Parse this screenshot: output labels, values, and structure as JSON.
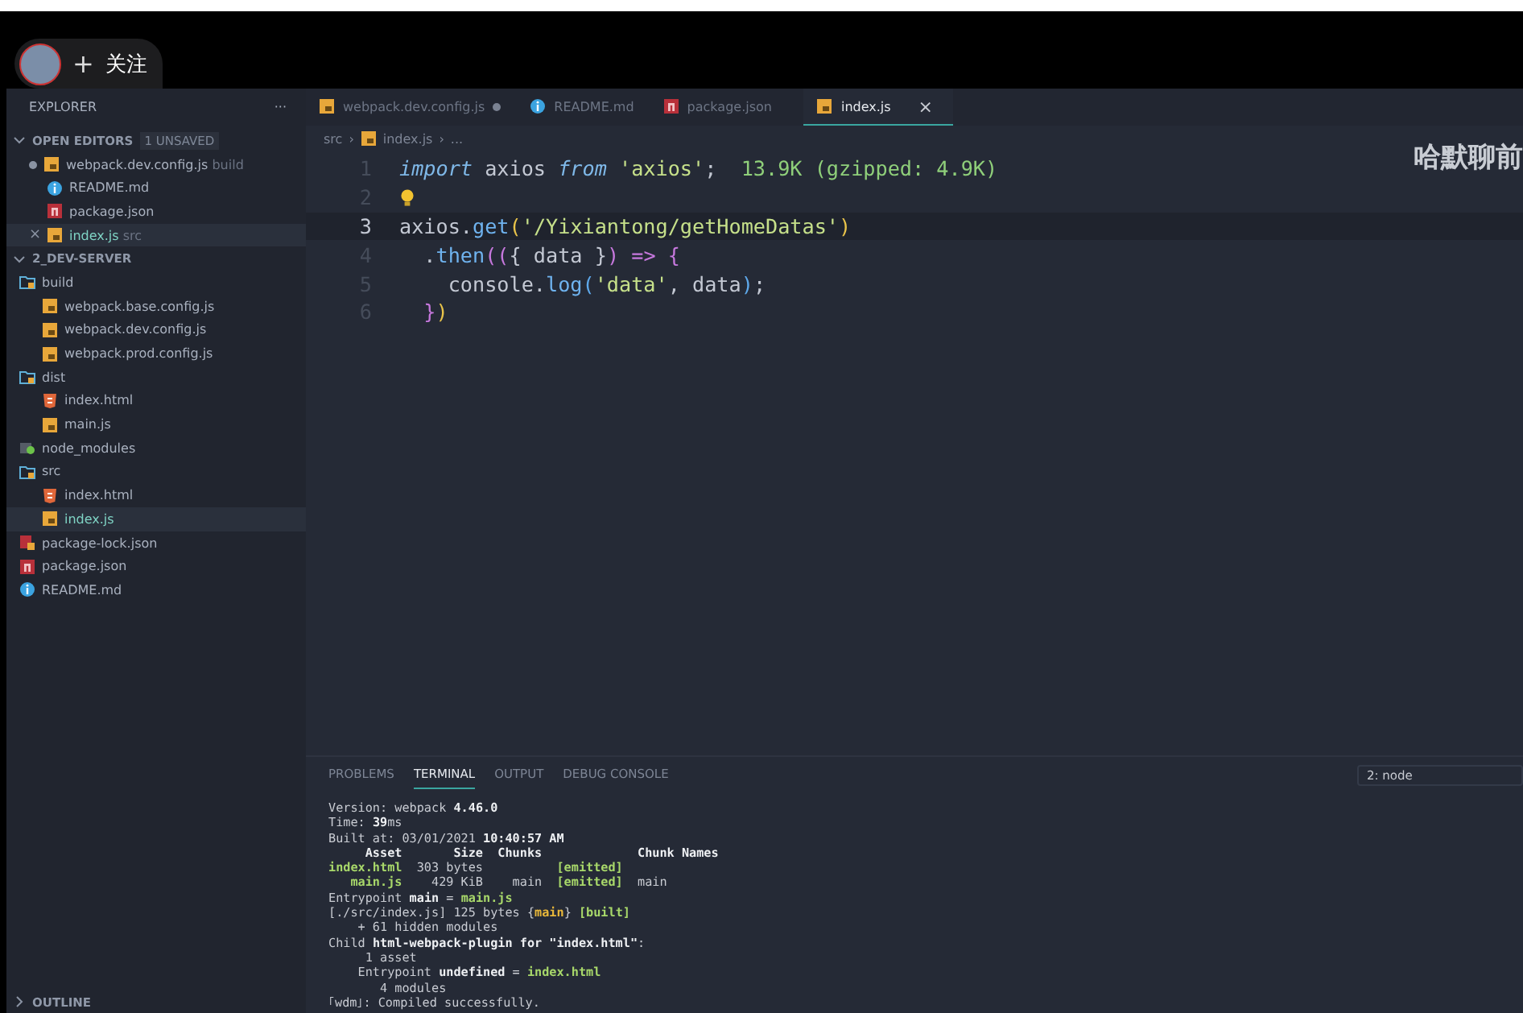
{
  "follow_button": {
    "icon": "+",
    "label": "关注"
  },
  "overlay_title": "哈默聊前",
  "sidebar": {
    "title": "EXPLORER",
    "more": "···",
    "open_editors": {
      "title": "OPEN EDITORS",
      "badge": "1 UNSAVED",
      "expanded": true,
      "items": [
        {
          "name": "webpack.dev.config.js",
          "hint": "build",
          "kind": "js",
          "dirty": true,
          "selected": false
        },
        {
          "name": "README.md",
          "kind": "info",
          "dirty": false,
          "selected": false
        },
        {
          "name": "package.json",
          "kind": "npm",
          "dirty": false,
          "selected": false
        },
        {
          "name": "index.js",
          "hint": "src",
          "kind": "js",
          "dirty": false,
          "selected": true,
          "close": "×"
        }
      ]
    },
    "project": {
      "title": "2_DEV-SERVER",
      "expanded": true,
      "tree": [
        {
          "name": "build",
          "kind": "folder",
          "expanded": true,
          "selected": false,
          "children": [
            {
              "name": "webpack.base.config.js",
              "kind": "js",
              "selected": false
            },
            {
              "name": "webpack.dev.config.js",
              "kind": "js",
              "selected": false
            },
            {
              "name": "webpack.prod.config.js",
              "kind": "js",
              "selected": false
            }
          ]
        },
        {
          "name": "dist",
          "kind": "folder",
          "expanded": true,
          "selected": false,
          "children": [
            {
              "name": "index.html",
              "kind": "html",
              "selected": false
            },
            {
              "name": "main.js",
              "kind": "js",
              "selected": false
            }
          ]
        },
        {
          "name": "node_modules",
          "kind": "node-folder",
          "expanded": false,
          "selected": false
        },
        {
          "name": "src",
          "kind": "folder",
          "expanded": true,
          "selected": false,
          "children": [
            {
              "name": "index.html",
              "kind": "html",
              "selected": false
            },
            {
              "name": "index.js",
              "kind": "js",
              "selected": true
            }
          ]
        },
        {
          "name": "package-lock.json",
          "kind": "npm-lock",
          "selected": false
        },
        {
          "name": "package.json",
          "kind": "npm",
          "selected": false
        },
        {
          "name": "README.md",
          "kind": "info",
          "selected": false
        }
      ]
    },
    "outline": {
      "title": "OUTLINE",
      "expanded": false
    }
  },
  "editor": {
    "tabs": [
      {
        "label": "webpack.dev.config.js",
        "kind": "js",
        "dirty": true,
        "selected": false
      },
      {
        "label": "README.md",
        "kind": "info",
        "dirty": false,
        "selected": false
      },
      {
        "label": "package.json",
        "kind": "npm",
        "dirty": false,
        "selected": false
      },
      {
        "label": "index.js",
        "kind": "js",
        "dirty": false,
        "selected": true,
        "close": "×"
      }
    ],
    "breadcrumb_separator": "›",
    "breadcrumb": [
      {
        "text": "src",
        "kind": "folder"
      },
      {
        "text": "index.js",
        "kind": "js"
      },
      {
        "text": "...",
        "kind": "more"
      }
    ],
    "lines": [
      {
        "number": "1",
        "active": false,
        "lightbulb": false,
        "tokens": [
          {
            "text": "import",
            "kind": "kw"
          },
          {
            "text": " axios ",
            "kind": "id"
          },
          {
            "text": "from",
            "kind": "kw"
          },
          {
            "text": " 'axios'",
            "kind": "str"
          },
          {
            "text": ";",
            "kind": "id"
          },
          {
            "text": "  13.9K (gzipped: 4.9K)",
            "kind": "cost"
          }
        ]
      },
      {
        "number": "2",
        "active": false,
        "lightbulb": true
      },
      {
        "number": "3",
        "active": true,
        "lightbulb": false,
        "tokens": [
          {
            "text": "axios",
            "kind": "id"
          },
          {
            "text": ".",
            "kind": "id"
          },
          {
            "text": "get",
            "kind": "fn"
          },
          {
            "text": "(",
            "kind": "p1"
          },
          {
            "text": "'/Yixiantong/getHomeDatas'",
            "kind": "str"
          },
          {
            "text": ")",
            "kind": "p1"
          }
        ]
      },
      {
        "number": "4",
        "active": false,
        "lightbulb": false,
        "tokens": [
          {
            "text": "  .",
            "kind": "id"
          },
          {
            "text": "then",
            "kind": "fn"
          },
          {
            "text": "((",
            "kind": "p2"
          },
          {
            "text": "{ data }",
            "kind": "id"
          },
          {
            "text": ")",
            "kind": "p2"
          },
          {
            "text": " => ",
            "kind": "kw2"
          },
          {
            "text": "{",
            "kind": "p2"
          }
        ]
      },
      {
        "number": "5",
        "active": false,
        "lightbulb": false,
        "tokens": [
          {
            "text": "    console.",
            "kind": "id"
          },
          {
            "text": "log",
            "kind": "fn"
          },
          {
            "text": "(",
            "kind": "p3"
          },
          {
            "text": "'data'",
            "kind": "str"
          },
          {
            "text": ", data",
            "kind": "id"
          },
          {
            "text": ")",
            "kind": "p3"
          },
          {
            "text": ";",
            "kind": "id"
          }
        ]
      },
      {
        "number": "6",
        "active": false,
        "lightbulb": false,
        "tokens": [
          {
            "text": "  }",
            "kind": "p2"
          },
          {
            "text": ")",
            "kind": "p1"
          }
        ]
      }
    ]
  },
  "panel": {
    "tabs": [
      {
        "label": "PROBLEMS",
        "selected": false
      },
      {
        "label": "TERMINAL",
        "selected": true
      },
      {
        "label": "OUTPUT",
        "selected": false
      },
      {
        "label": "DEBUG CONSOLE",
        "selected": false
      }
    ],
    "terminal_select": "2: node",
    "lines": [
      [
        {
          "text": "Version: webpack ",
          "kind": "plain"
        },
        {
          "text": "4.46.0",
          "kind": "bold"
        }
      ],
      [
        {
          "text": "Time: ",
          "kind": "plain"
        },
        {
          "text": "39",
          "kind": "bold"
        },
        {
          "text": "ms",
          "kind": "plain"
        }
      ],
      [
        {
          "text": "Built at: 03/01/2021 ",
          "kind": "plain"
        },
        {
          "text": "10:40:57 AM",
          "kind": "bold"
        }
      ],
      [
        {
          "text": "     Asset       Size  Chunks             Chunk Names",
          "kind": "bold"
        }
      ],
      [
        {
          "text": "index.html",
          "kind": "green"
        },
        {
          "text": "  303 bytes          ",
          "kind": "plain"
        },
        {
          "text": "[emitted]",
          "kind": "green"
        }
      ],
      [
        {
          "text": "   main.js",
          "kind": "green"
        },
        {
          "text": "    429 KiB    main  ",
          "kind": "plain"
        },
        {
          "text": "[emitted]",
          "kind": "green"
        },
        {
          "text": "  main",
          "kind": "plain"
        }
      ],
      [
        {
          "text": "Entrypoint ",
          "kind": "plain"
        },
        {
          "text": "main",
          "kind": "bold"
        },
        {
          "text": " = ",
          "kind": "plain"
        },
        {
          "text": "main.js",
          "kind": "green"
        }
      ],
      [
        {
          "text": "[./src/index.js] 125 bytes {",
          "kind": "plain"
        },
        {
          "text": "main",
          "kind": "yellow"
        },
        {
          "text": "} ",
          "kind": "plain"
        },
        {
          "text": "[built]",
          "kind": "green"
        }
      ],
      [
        {
          "text": "    + 61 hidden modules",
          "kind": "plain"
        }
      ],
      [
        {
          "text": "Child ",
          "kind": "plain"
        },
        {
          "text": "html-webpack-plugin for \"index.html\"",
          "kind": "bold"
        },
        {
          "text": ":",
          "kind": "plain"
        }
      ],
      [
        {
          "text": "     1 asset",
          "kind": "plain"
        }
      ],
      [
        {
          "text": "    Entrypoint ",
          "kind": "plain"
        },
        {
          "text": "undefined",
          "kind": "bold"
        },
        {
          "text": " = ",
          "kind": "plain"
        },
        {
          "text": "index.html",
          "kind": "green"
        }
      ],
      [
        {
          "text": "       4 modules",
          "kind": "plain"
        }
      ],
      [
        {
          "text": "｢wdm｣: Compiled successfully.",
          "kind": "plain"
        }
      ]
    ]
  }
}
